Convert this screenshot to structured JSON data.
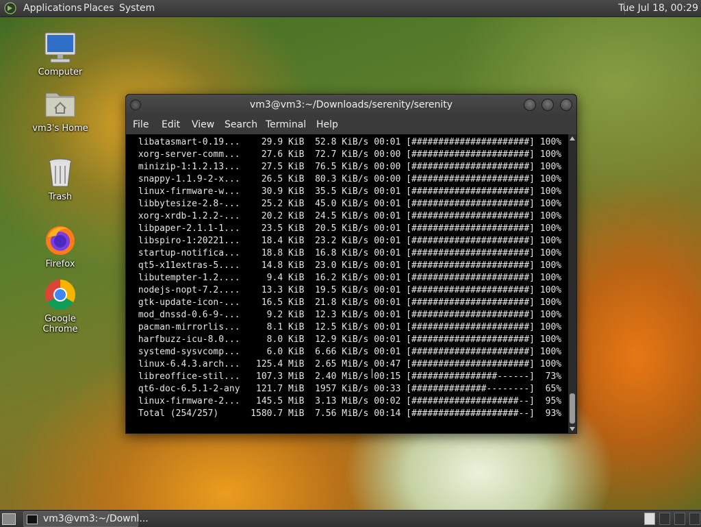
{
  "top_panel": {
    "menus": [
      "Applications",
      "Places",
      "System"
    ],
    "clock": "Tue Jul 18, 00:29"
  },
  "desktop_icons": [
    {
      "label": "Computer",
      "icon": "computer-icon"
    },
    {
      "label": "vm3's Home",
      "icon": "home-folder-icon"
    },
    {
      "label": "Trash",
      "icon": "trash-icon"
    },
    {
      "label": "Firefox",
      "icon": "firefox-icon"
    },
    {
      "label": "Google Chrome",
      "icon": "chrome-icon"
    }
  ],
  "window": {
    "title": "vm3@vm3:~/Downloads/serenity/serenity",
    "menu": [
      "File",
      "Edit",
      "View",
      "Search",
      "Terminal",
      "Help"
    ]
  },
  "terminal_lines": [
    " libatasmart-0.19...    29.9 KiB  52.8 KiB/s 00:01 [######################] 100%",
    " xorg-server-comm...    27.6 KiB  72.7 KiB/s 00:00 [######################] 100%",
    " minizip-1:1.2.13...    27.5 KiB  76.5 KiB/s 00:00 [######################] 100%",
    " snappy-1.1.9-2-x...    26.5 KiB  80.3 KiB/s 00:00 [######################] 100%",
    " linux-firmware-w...    30.9 KiB  35.5 KiB/s 00:01 [######################] 100%",
    " libbytesize-2.8-...    25.2 KiB  45.0 KiB/s 00:01 [######################] 100%",
    " xorg-xrdb-1.2.2-...    20.2 KiB  24.5 KiB/s 00:01 [######################] 100%",
    " libpaper-2.1.1-1...    23.5 KiB  20.5 KiB/s 00:01 [######################] 100%",
    " libspiro-1:20221...    18.4 KiB  23.2 KiB/s 00:01 [######################] 100%",
    " startup-notifica...    18.8 KiB  16.8 KiB/s 00:01 [######################] 100%",
    " qt5-x11extras-5....    14.8 KiB  23.0 KiB/s 00:01 [######################] 100%",
    " libutempter-1.2....     9.4 KiB  16.2 KiB/s 00:01 [######################] 100%",
    " nodejs-nopt-7.2....    13.3 KiB  19.5 KiB/s 00:01 [######################] 100%",
    " gtk-update-icon-...    16.5 KiB  21.8 KiB/s 00:01 [######################] 100%",
    " mod_dnssd-0.6-9-...     9.2 KiB  12.3 KiB/s 00:01 [######################] 100%",
    " pacman-mirrorlis...     8.1 KiB  12.5 KiB/s 00:01 [######################] 100%",
    " harfbuzz-icu-8.0...     8.0 KiB  12.9 KiB/s 00:01 [######################] 100%",
    " systemd-sysvcomp...     6.0 KiB  6.66 KiB/s 00:01 [######################] 100%",
    " linux-6.4.3.arch...   125.4 MiB  2.65 MiB/s 00:47 [######################] 100%",
    " libreoffice-stil...   107.3 MiB  2.40 MiB/s 00:15 [################------]  73%",
    " qt6-doc-6.5.1-2-any   121.7 MiB  1957 KiB/s 00:33 [##############--------]  65%",
    " linux-firmware-2...   145.5 MiB  3.13 MiB/s 00:02 [####################--]  95%",
    " Total (254/257)      1580.7 MiB  7.56 MiB/s 00:14 [####################--]  93%"
  ],
  "taskbar": {
    "task_label": "vm3@vm3:~/Downl..."
  }
}
